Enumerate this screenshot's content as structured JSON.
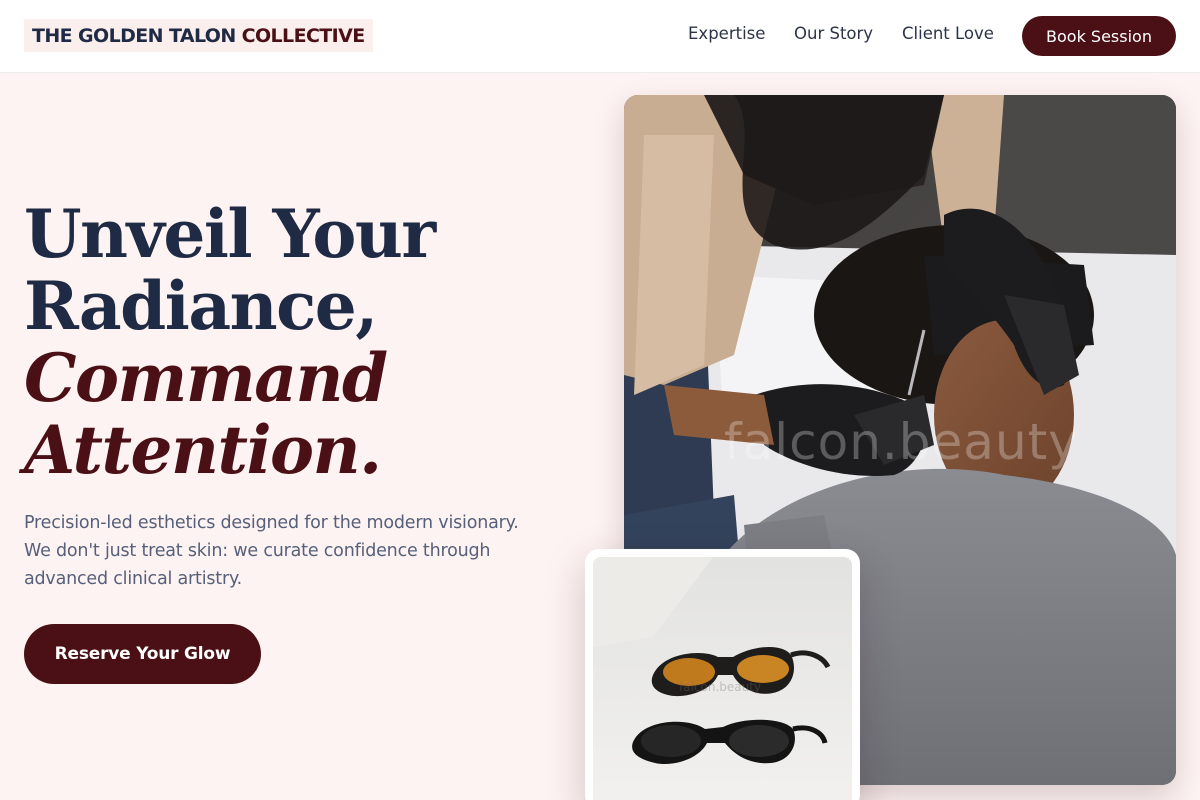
{
  "header": {
    "logo_part1": "THE GOLDEN TALON",
    "logo_part2": "COLLECTIVE",
    "nav": [
      "Expertise",
      "Our Story",
      "Client Love"
    ],
    "book_label": "Book Session"
  },
  "hero": {
    "headline_line1": "Unveil Your",
    "headline_line2": "Radiance,",
    "headline_line3": "Command",
    "headline_line4": "Attention.",
    "subtext": "Precision-led esthetics designed for the modern visionary. We don't just treat skin: we curate confidence through advanced clinical artistry.",
    "cta_label": "Reserve Your Glow",
    "image_watermark": "falcon.beauty",
    "small_image_watermark": "falcon.beauty"
  },
  "colors": {
    "brand": "#4a1016",
    "navy": "#1f2a44",
    "background": "#fdf3f2"
  }
}
